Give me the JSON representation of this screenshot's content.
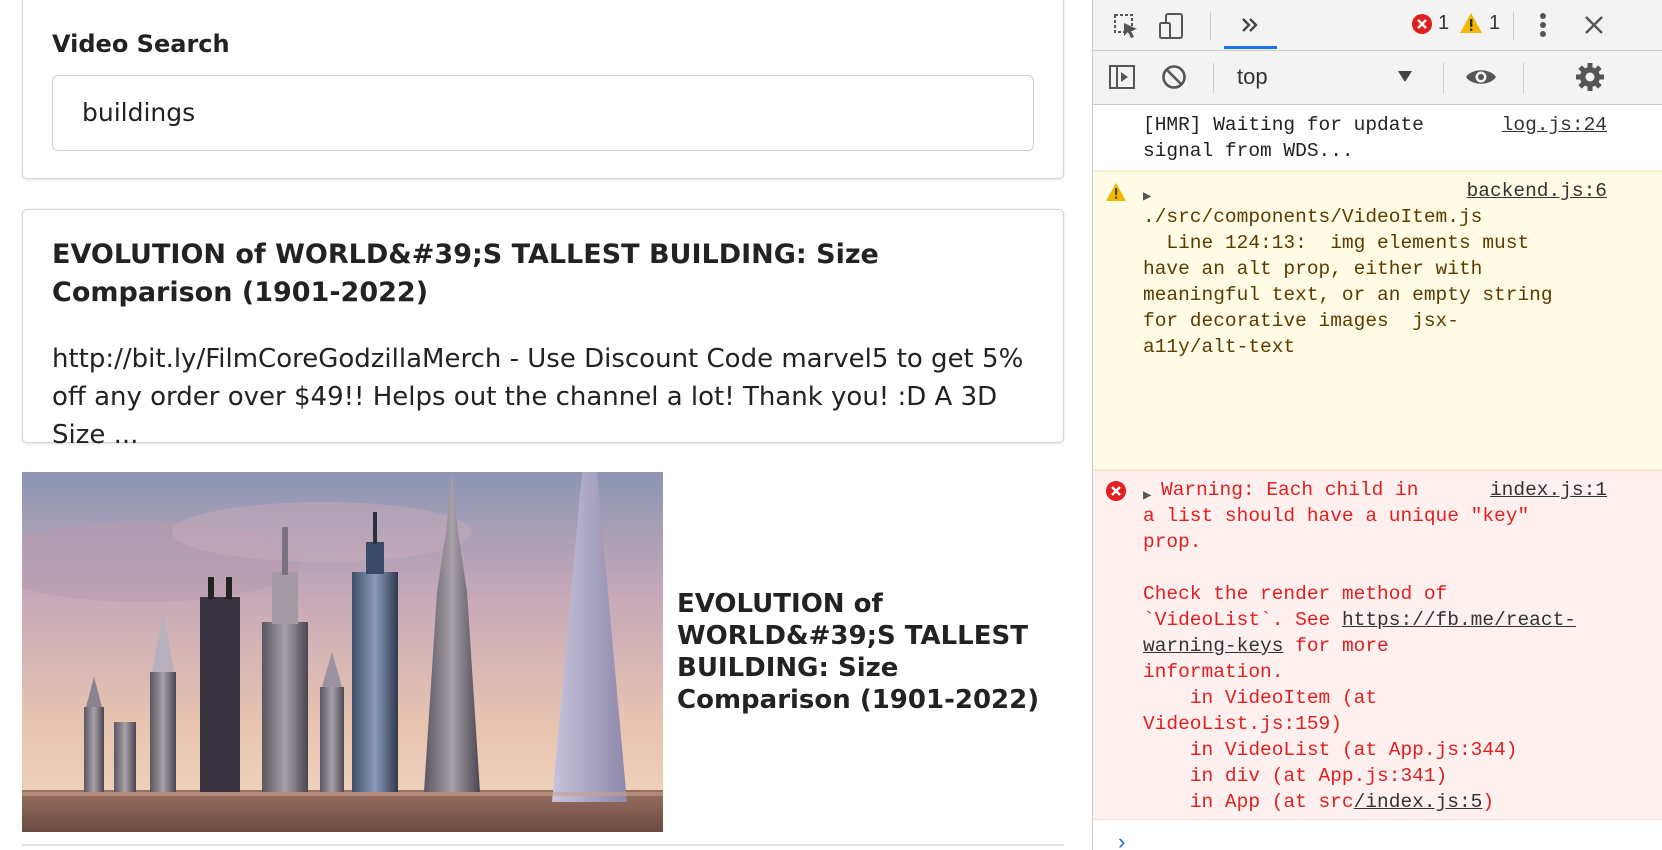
{
  "search": {
    "label": "Video Search",
    "value": "buildings"
  },
  "video_detail": {
    "title": "EVOLUTION of WORLD&#39;S TALLEST BUILDING: Size Comparison (1901-2022)",
    "description": "http://bit.ly/FilmCoreGodzillaMerch - Use Discount Code marvel5 to get 5% off any order over $49!! Helps out the channel a lot! Thank you! :D A 3D Size ..."
  },
  "video_list": {
    "items": [
      {
        "title": "EVOLUTION of WORLD&#39;S TALLEST BUILDING: Size Comparison (1901-2022)"
      }
    ]
  },
  "devtools": {
    "error_count": "1",
    "warning_count": "1",
    "context": "top",
    "console": {
      "log": {
        "text": "[HMR] Waiting for update\nsignal from WDS...",
        "source": "log.js:24"
      },
      "warning": {
        "source": "backend.js:6",
        "text": "./src/components/VideoItem.js\n  Line 124:13:  img elements must\nhave an alt prop, either with\nmeaningful text, or an empty string\nfor decorative images  jsx-\na11y/alt-text"
      },
      "error": {
        "source": "index.js:1",
        "text_1": "Warning: Each child in\na list should have a unique \"key\"\nprop.\n\nCheck the render method of\n`VideoList`. See ",
        "link": "https://fb.me/react-warning-keys",
        "link_line_1": "https://fb.me/reac",
        "link_line_2": "t-warning-keys",
        "text_2": " for more\ninformation.\n    in VideoItem (at\nVideoList.js:159)\n    in VideoList (at App.js:344)\n    in div (at App.js:341)\n    in App (at src",
        "stack_link": "/index.js:5",
        "text_3": ")"
      },
      "prompt": "›"
    }
  },
  "colors": {
    "error_red": "#e02020",
    "warning_bg": "#fffbe5",
    "error_bg": "#fff0f0",
    "devtools_accent": "#1a73e8"
  }
}
